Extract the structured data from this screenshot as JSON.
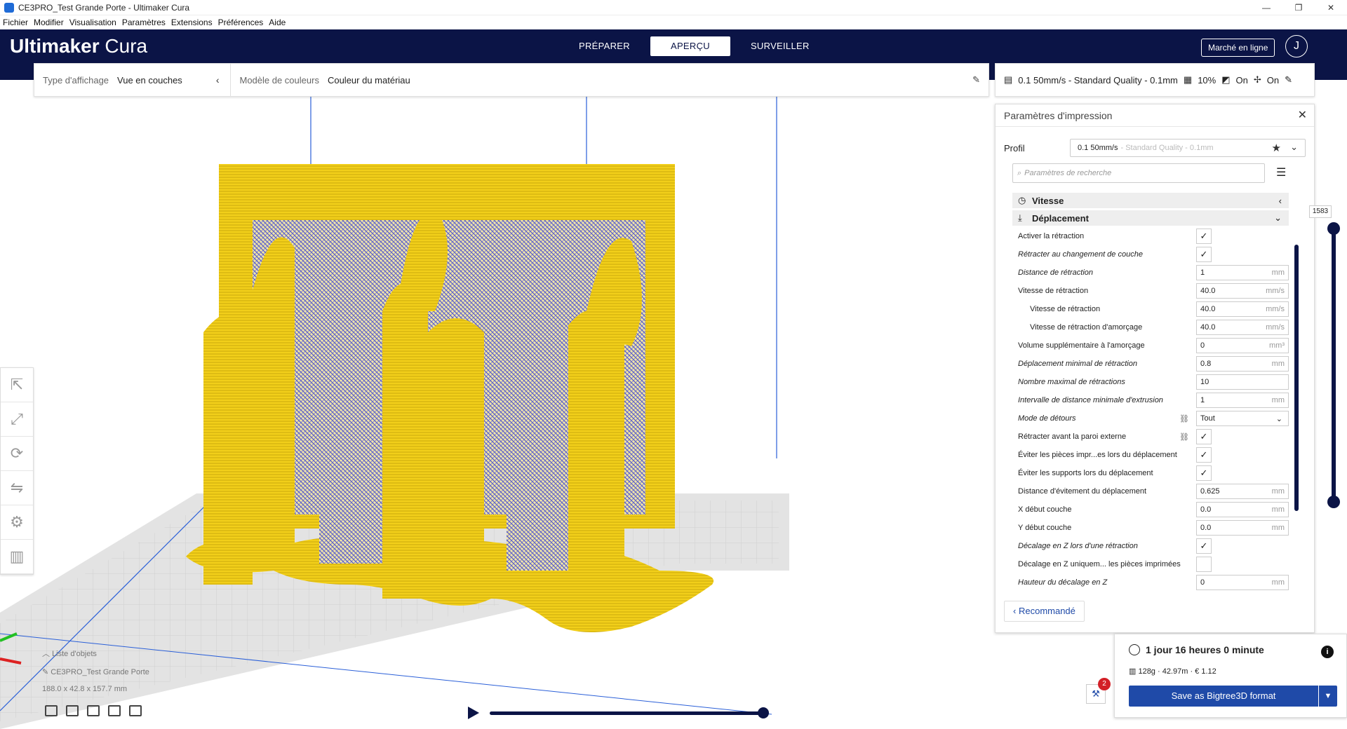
{
  "window": {
    "title": "CE3PRO_Test Grande Porte - Ultimaker Cura",
    "minimize": "—",
    "maximize": "❐",
    "close": "✕"
  },
  "menu": [
    "Fichier",
    "Modifier",
    "Visualisation",
    "Paramètres",
    "Extensions",
    "Préférences",
    "Aide"
  ],
  "header": {
    "logo_bold": "Ultimaker",
    "logo_light": " Cura",
    "stages": [
      {
        "label": "PRÉPARER",
        "active": false
      },
      {
        "label": "APERÇU",
        "active": true
      },
      {
        "label": "SURVEILLER",
        "active": false
      }
    ],
    "marketplace": "Marché en ligne",
    "account_initial": "J"
  },
  "viewbar": {
    "type_label": "Type d'affichage",
    "type_value": "Vue en couches",
    "color_label": "Modèle de couleurs",
    "color_value": "Couleur du matériau"
  },
  "printbar": {
    "profile": "0.1 50mm/s - Standard Quality - 0.1mm",
    "infill": "10%",
    "support": "On",
    "adhesion": "On"
  },
  "panel": {
    "title": "Paramètres d'impression",
    "profile_label": "Profil",
    "profile_value": "0.1 50mm/s",
    "profile_faint": " - Standard Quality - 0.1mm",
    "search_placeholder": "Paramètres de recherche",
    "cat_speed": "Vitesse",
    "cat_travel": "Déplacement",
    "recommended": "Recommandé",
    "settings": [
      {
        "label": "Activer la rétraction",
        "kind": "check",
        "checked": true,
        "italic": false,
        "indent": false
      },
      {
        "label": "Rétracter au changement de couche",
        "kind": "check",
        "checked": true,
        "italic": true,
        "indent": false
      },
      {
        "label": "Distance de rétraction",
        "kind": "field",
        "value": "1",
        "unit": "mm",
        "italic": true,
        "indent": false
      },
      {
        "label": "Vitesse de rétraction",
        "kind": "field",
        "value": "40.0",
        "unit": "mm/s",
        "italic": false,
        "indent": false
      },
      {
        "label": "Vitesse de rétraction",
        "kind": "field",
        "value": "40.0",
        "unit": "mm/s",
        "italic": false,
        "indent": true
      },
      {
        "label": "Vitesse de rétraction d'amorçage",
        "kind": "field",
        "value": "40.0",
        "unit": "mm/s",
        "italic": false,
        "indent": true
      },
      {
        "label": "Volume supplémentaire à l'amorçage",
        "kind": "field",
        "value": "0",
        "unit": "mm³",
        "italic": false,
        "indent": false
      },
      {
        "label": "Déplacement minimal de rétraction",
        "kind": "field",
        "value": "0.8",
        "unit": "mm",
        "italic": true,
        "indent": false
      },
      {
        "label": "Nombre maximal de rétractions",
        "kind": "field",
        "value": "10",
        "unit": "",
        "italic": true,
        "indent": false
      },
      {
        "label": "Intervalle de distance minimale d'extrusion",
        "kind": "field",
        "value": "1",
        "unit": "mm",
        "italic": true,
        "indent": false
      },
      {
        "label": "Mode de détours",
        "kind": "select",
        "value": "Tout",
        "italic": true,
        "indent": false,
        "link": true
      },
      {
        "label": "Rétracter avant la paroi externe",
        "kind": "check",
        "checked": true,
        "italic": false,
        "indent": false,
        "link": true
      },
      {
        "label": "Éviter les pièces impr...es lors du déplacement",
        "kind": "check",
        "checked": true,
        "italic": false,
        "indent": false
      },
      {
        "label": "Éviter les supports lors du déplacement",
        "kind": "check",
        "checked": true,
        "italic": false,
        "indent": false
      },
      {
        "label": "Distance d'évitement du déplacement",
        "kind": "field",
        "value": "0.625",
        "unit": "mm",
        "italic": false,
        "indent": false
      },
      {
        "label": "X début couche",
        "kind": "field",
        "value": "0.0",
        "unit": "mm",
        "italic": false,
        "indent": false
      },
      {
        "label": "Y début couche",
        "kind": "field",
        "value": "0.0",
        "unit": "mm",
        "italic": false,
        "indent": false
      },
      {
        "label": "Décalage en Z lors d'une rétraction",
        "kind": "check",
        "checked": true,
        "italic": true,
        "indent": false
      },
      {
        "label": "Décalage en Z uniquem... les pièces imprimées",
        "kind": "check",
        "checked": false,
        "italic": false,
        "indent": false
      },
      {
        "label": "Hauteur du décalage en Z",
        "kind": "field",
        "value": "0",
        "unit": "mm",
        "italic": true,
        "indent": false
      }
    ]
  },
  "layer_slider": {
    "value": "1583"
  },
  "objects": {
    "title": "Liste d'objets",
    "name": "CE3PRO_Test Grande Porte",
    "dims": "188.0 x 42.8 x 157.7 mm"
  },
  "marketplace_badge": "2",
  "estimate": {
    "time": "1 jour 16 heures 0 minute",
    "material": "128g · 42.97m · € 1.12",
    "save": "Save as Bigtree3D format"
  },
  "colors": {
    "navy": "#0b1446",
    "accent": "#1f4aa8",
    "model": "#f2cf1a",
    "travel": "#5558c8"
  },
  "icons": {
    "info": "i",
    "chevron": "‹"
  }
}
